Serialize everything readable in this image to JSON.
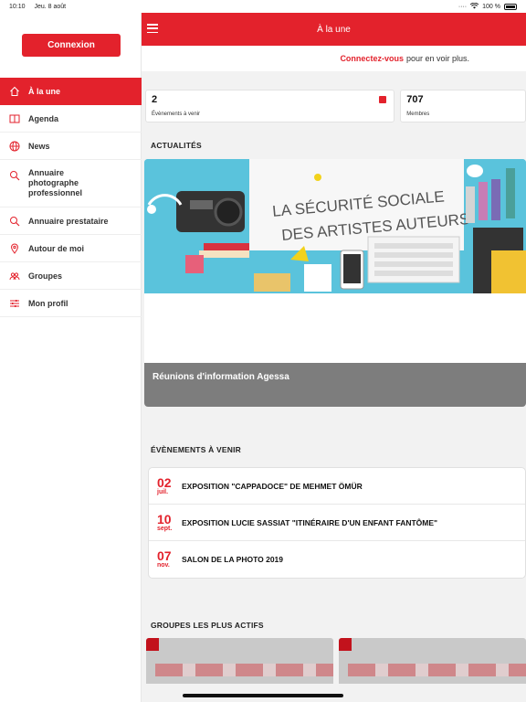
{
  "status_bar": {
    "time": "10:10",
    "date": "Jeu. 8 août",
    "battery": "100 %"
  },
  "sidebar": {
    "login_label": "Connexion",
    "items": [
      {
        "label": "À la une",
        "icon": "home-icon",
        "active": true
      },
      {
        "label": "Agenda",
        "icon": "book-icon"
      },
      {
        "label": "News",
        "icon": "globe-icon"
      },
      {
        "label": "Annuaire photographe professionnel",
        "icon": "search-icon"
      },
      {
        "label": "Annuaire prestataire",
        "icon": "search-icon"
      },
      {
        "label": "Autour de moi",
        "icon": "location-pin-icon"
      },
      {
        "label": "Groupes",
        "icon": "people-icon"
      },
      {
        "label": "Mon profil",
        "icon": "sliders-icon"
      }
    ]
  },
  "header": {
    "title": "À la une"
  },
  "connect_prompt": {
    "link": "Connectez-vous",
    "rest": "pour en voir plus."
  },
  "stats": [
    {
      "value": "2",
      "label": "Évènements à venir"
    },
    {
      "value": "707",
      "label": "Membres"
    }
  ],
  "news": {
    "section_title": "ACTUALITÉS",
    "image_text_line1": "LA SÉCURITÉ SOCIALE",
    "image_text_line2": "DES ARTISTES AUTEURS",
    "caption": "Réunions d'information Agessa"
  },
  "events": {
    "section_title": "ÉVÈNEMENTS À VENIR",
    "items": [
      {
        "day": "02",
        "month": "juil.",
        "title": "EXPOSITION \"CAPPADOCE\" DE MEHMET ÖMÜR"
      },
      {
        "day": "10",
        "month": "sept.",
        "title": "EXPOSITION LUCIE SASSIAT \"ITINÉRAIRE D'UN ENFANT FANTÔME\""
      },
      {
        "day": "07",
        "month": "nov.",
        "title": "SALON DE LA PHOTO 2019"
      }
    ]
  },
  "groups": {
    "section_title": "GROUPES LES PLUS ACTIFS"
  },
  "colors": {
    "accent": "#e3222c",
    "sky": "#5ac3dc",
    "caption_bg": "#7d7d7d"
  }
}
